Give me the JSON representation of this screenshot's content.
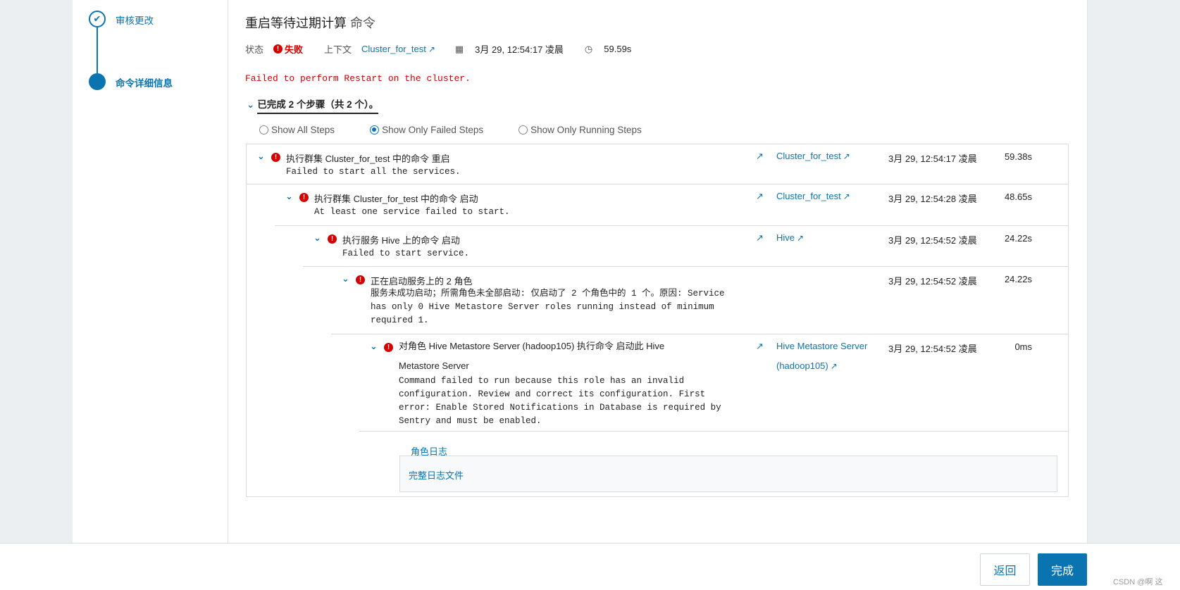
{
  "stepper": {
    "steps": [
      {
        "label": "审核更改",
        "state": "done"
      },
      {
        "label": "命令详细信息",
        "state": "current"
      }
    ]
  },
  "header": {
    "title": "重启等待过期计算",
    "title_suffix": "命令"
  },
  "meta": {
    "status_label": "状态",
    "status_value": "失败",
    "context_label": "上下文",
    "context_link": "Cluster_for_test",
    "date": "3月 29, 12:54:17 凌晨",
    "duration": "59.59s"
  },
  "error_message": "Failed to perform Restart on the cluster.",
  "summary": "已完成 2 个步骤（共 2 个）。",
  "filters": {
    "options": [
      "Show All Steps",
      "Show Only Failed Steps",
      "Show Only Running Steps"
    ],
    "selected": "Show Only Failed Steps"
  },
  "steps": [
    {
      "title": "执行群集 Cluster_for_test 中的命令 重启",
      "desc": "Failed to start all the services.",
      "link": "Cluster_for_test",
      "date": "3月 29, 12:54:17 凌晨",
      "duration": "59.38s"
    },
    {
      "title": "执行群集 Cluster_for_test 中的命令 启动",
      "desc": "At least one service failed to start.",
      "link": "Cluster_for_test",
      "date": "3月 29, 12:54:28 凌晨",
      "duration": "48.65s"
    },
    {
      "title": "执行服务 Hive 上的命令 启动",
      "desc": "Failed to start service.",
      "link": "Hive",
      "date": "3月 29, 12:54:52 凌晨",
      "duration": "24.22s"
    },
    {
      "title": "正在启动服务上的 2 角色",
      "desc": "服务未成功启动；所需角色未全部启动: 仅启动了 2 个角色中的 1 个。原因: Service\nhas only 0 Hive Metastore Server roles running instead of minimum\nrequired 1.",
      "link": "",
      "date": "3月 29, 12:54:52 凌晨",
      "duration": "24.22s"
    },
    {
      "title": "对角色 Hive Metastore Server (hadoop105) 执行命令 启动此 Hive\nMetastore Server",
      "desc": "Command failed to run because this role has an invalid\nconfiguration. Review and correct its configuration. First\nerror: Enable Stored Notifications in Database is required by\nSentry and must be enabled.",
      "link": "Hive Metastore Server\n(hadoop105)",
      "date": "3月 29, 12:54:52 凌晨",
      "duration": "0ms"
    }
  ],
  "log_tabs": {
    "tab": "角色日志",
    "link": "完整日志文件"
  },
  "footer": {
    "back": "返回",
    "done": "完成"
  },
  "watermark": "CSDN @啊 这",
  "colors": {
    "accent": "#0a74b0",
    "error": "#d40000"
  }
}
